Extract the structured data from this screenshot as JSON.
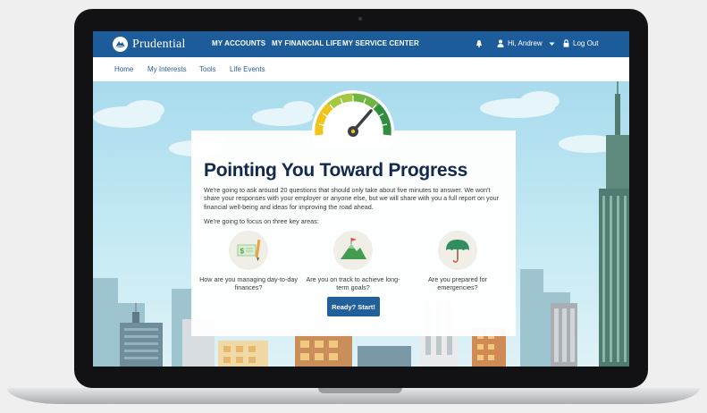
{
  "brand": {
    "name": "Prudential"
  },
  "topnav": {
    "items": [
      "MY ACCOUNTS",
      "MY FINANCIAL LIFE",
      "MY SERVICE CENTER"
    ],
    "greeting": "Hi, Andrew",
    "logout": "Log Out"
  },
  "subnav": {
    "items": [
      "Home",
      "My Interests",
      "Tools",
      "Life Events"
    ]
  },
  "main": {
    "heading": "Pointing You Toward Progress",
    "intro": "We're going to ask around 20 questions that should only take about five minutes to answer. We won't share your responses with your employer or anyone else, but we will share with you a full report on your financial well-being and ideas for improving the road ahead.",
    "focus_label": "We're going to focus on three key areas:",
    "areas": [
      {
        "text": "How are you managing day-to-day finances?",
        "icon": "finance-check-icon"
      },
      {
        "text": "Are you on track to achieve long-term goals?",
        "icon": "mountain-flag-icon"
      },
      {
        "text": "Are you prepared for emergencies?",
        "icon": "umbrella-icon"
      }
    ],
    "cta": "Ready? Start!"
  },
  "colors": {
    "brand_blue": "#1d5c9a",
    "heading_navy": "#0d2247",
    "sky": "#a8dbee"
  }
}
